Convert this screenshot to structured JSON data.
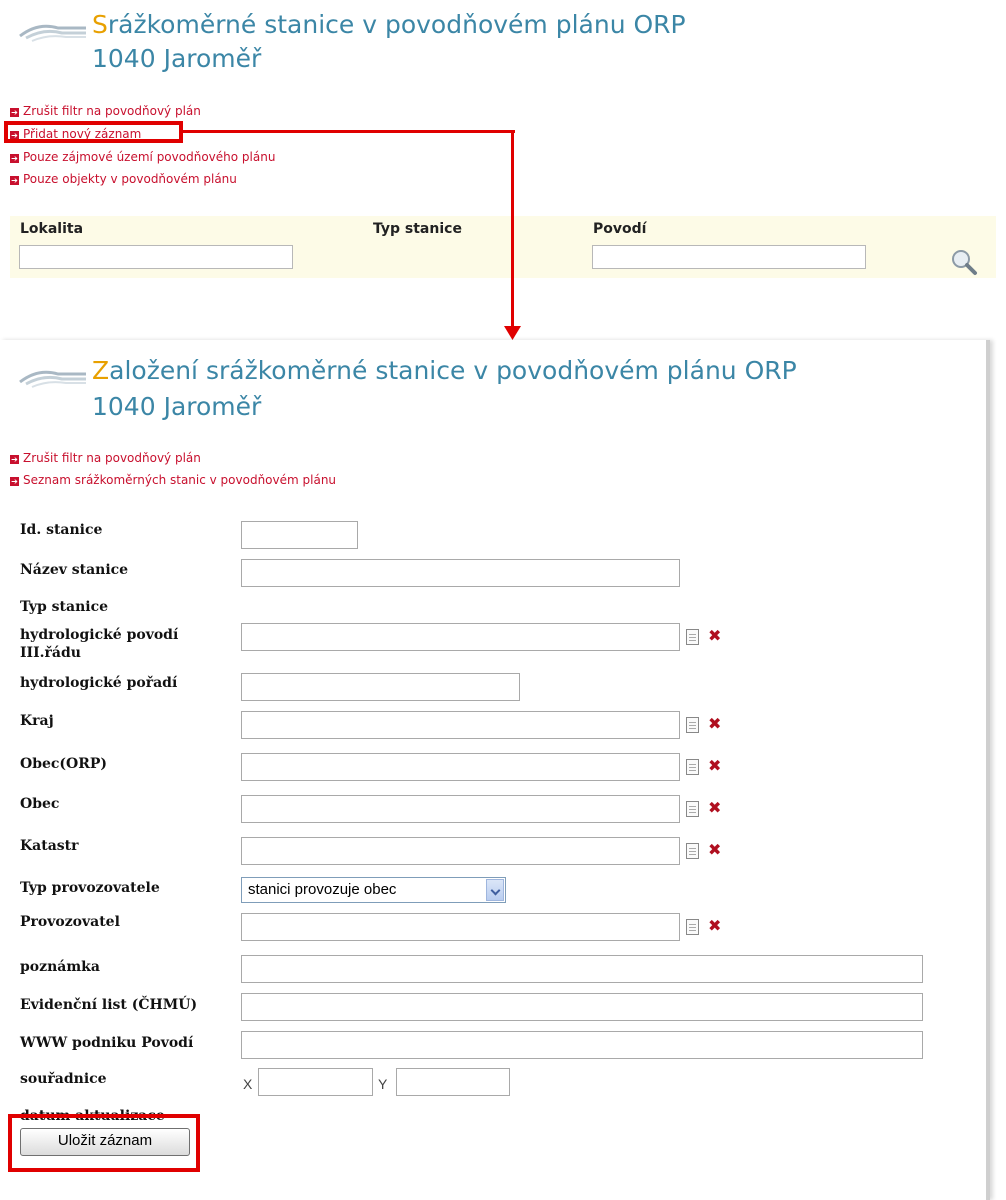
{
  "list_page": {
    "title_initial": "S",
    "title_rest": "rážkoměrné stanice v povodňovém plánu ORP",
    "subtitle": "1040 Jaroměř",
    "links": [
      "Zrušit filtr na povodňový plán",
      "Přidat nový záznam",
      "Pouze zájmové území povodňového plánu",
      "Pouze objekty v povodňovém plánu"
    ],
    "filters": {
      "lokalita": "Lokalita",
      "typ_stanice": "Typ stanice",
      "povodi": "Povodí"
    }
  },
  "form_page": {
    "title_initial": "Z",
    "title_rest": "aložení srážkoměrné stanice v povodňovém plánu ORP",
    "subtitle": "1040 Jaroměř",
    "links": [
      "Zrušit filtr na povodňový plán",
      "Seznam srážkoměrných stanic v povodňovém plánu"
    ],
    "fields": {
      "id_stanice": "Id. stanice",
      "nazev_stanice": "Název stanice",
      "typ_stanice": "Typ stanice",
      "hydro_povodi": "hydrologické povodí III.řádu",
      "hydro_poradi": "hydrologické pořadí",
      "kraj": "Kraj",
      "obec_orp": "Obec(ORP)",
      "obec": "Obec",
      "katastr": "Katastr",
      "typ_provozovatele": "Typ provozovatele",
      "provozovatel": "Provozovatel",
      "poznamka": "poznámka",
      "evidencni_list": "Evidenční list (ČHMÚ)",
      "www_povodi": "WWW podniku Povodí",
      "souradnice": "souřadnice",
      "datum_aktualizace": "datum aktualizace"
    },
    "typ_provozovatele_value": "stanici provozuje obec",
    "coord_x": "X",
    "coord_y": "Y",
    "save_label": "Uložit záznam"
  },
  "colors": {
    "title": "#3b86a6",
    "title_initial": "#e8a000",
    "link": "#c8102e",
    "highlight": "#e00000",
    "filter_bg": "#fdfbe7"
  }
}
